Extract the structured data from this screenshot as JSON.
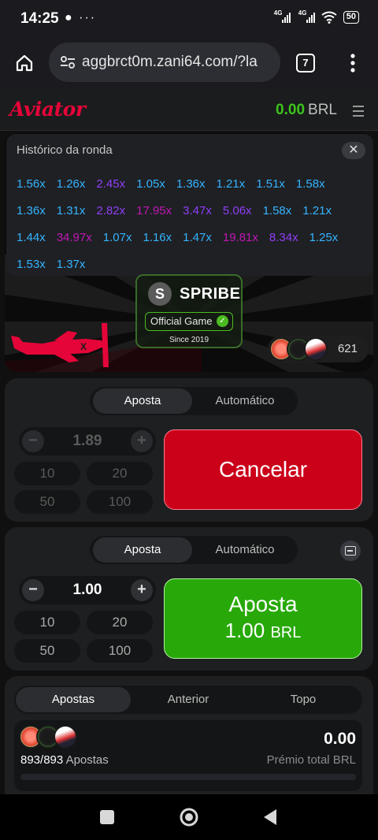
{
  "status_bar": {
    "time": "14:25",
    "network_left": "4G",
    "network_right": "4G",
    "battery": "50"
  },
  "browser": {
    "url": "aggbrct0m.zani64.com/?la",
    "tab_count": "7"
  },
  "game": {
    "logo": "Aviator",
    "balance_amount": "0.00",
    "balance_currency": "BRL"
  },
  "history": {
    "title": "Histórico da ronda",
    "rows": [
      [
        {
          "v": "1.56x",
          "c": "blue"
        },
        {
          "v": "1.26x",
          "c": "blue"
        },
        {
          "v": "2.45x",
          "c": "purple"
        },
        {
          "v": "1.05x",
          "c": "blue"
        },
        {
          "v": "1.36x",
          "c": "blue"
        },
        {
          "v": "1.21x",
          "c": "blue"
        },
        {
          "v": "1.51x",
          "c": "blue"
        },
        {
          "v": "1.58x",
          "c": "blue"
        }
      ],
      [
        {
          "v": "1.36x",
          "c": "blue"
        },
        {
          "v": "1.31x",
          "c": "blue"
        },
        {
          "v": "2.82x",
          "c": "purple"
        },
        {
          "v": "17.95x",
          "c": "pink"
        },
        {
          "v": "3.47x",
          "c": "purple"
        },
        {
          "v": "5.06x",
          "c": "purple"
        },
        {
          "v": "1.58x",
          "c": "blue"
        },
        {
          "v": "1.21x",
          "c": "blue"
        }
      ],
      [
        {
          "v": "1.44x",
          "c": "blue"
        },
        {
          "v": "34.97x",
          "c": "pink"
        },
        {
          "v": "1.07x",
          "c": "blue"
        },
        {
          "v": "1.16x",
          "c": "blue"
        },
        {
          "v": "1.47x",
          "c": "blue"
        },
        {
          "v": "19.81x",
          "c": "pink"
        },
        {
          "v": "8.34x",
          "c": "purple"
        },
        {
          "v": "1.25x",
          "c": "blue"
        }
      ],
      [
        {
          "v": "1.53x",
          "c": "blue"
        },
        {
          "v": "1.37x",
          "c": "blue"
        }
      ]
    ]
  },
  "badge": {
    "brand": "SPRIBE",
    "official": "Official Game",
    "since": "Since 2019"
  },
  "players_online": "621",
  "panel1": {
    "tab_active": "Aposta",
    "tab_other": "Automático",
    "amount": "1.89",
    "chips": [
      "10",
      "20",
      "50",
      "100"
    ],
    "action": "Cancelar"
  },
  "panel2": {
    "tab_active": "Aposta",
    "tab_other": "Automático",
    "amount": "1.00",
    "chips": [
      "10",
      "20",
      "50",
      "100"
    ],
    "action_line1": "Aposta",
    "action_amount": "1.00",
    "action_currency": "BRL"
  },
  "bets": {
    "tabs": [
      "Apostas",
      "Anterior",
      "Topo"
    ],
    "count": "893/893",
    "count_label": "Apostas",
    "total_prize": "0.00",
    "total_prize_label": "Prémio total BRL"
  },
  "colors": {
    "accent_red": "#e50539",
    "balance_green": "#3cc51b",
    "cancel_red": "#cb011a",
    "bet_green": "#28a909",
    "mult_blue": "#34b4ff",
    "mult_purple": "#913ef8",
    "mult_pink": "#c017b4"
  }
}
